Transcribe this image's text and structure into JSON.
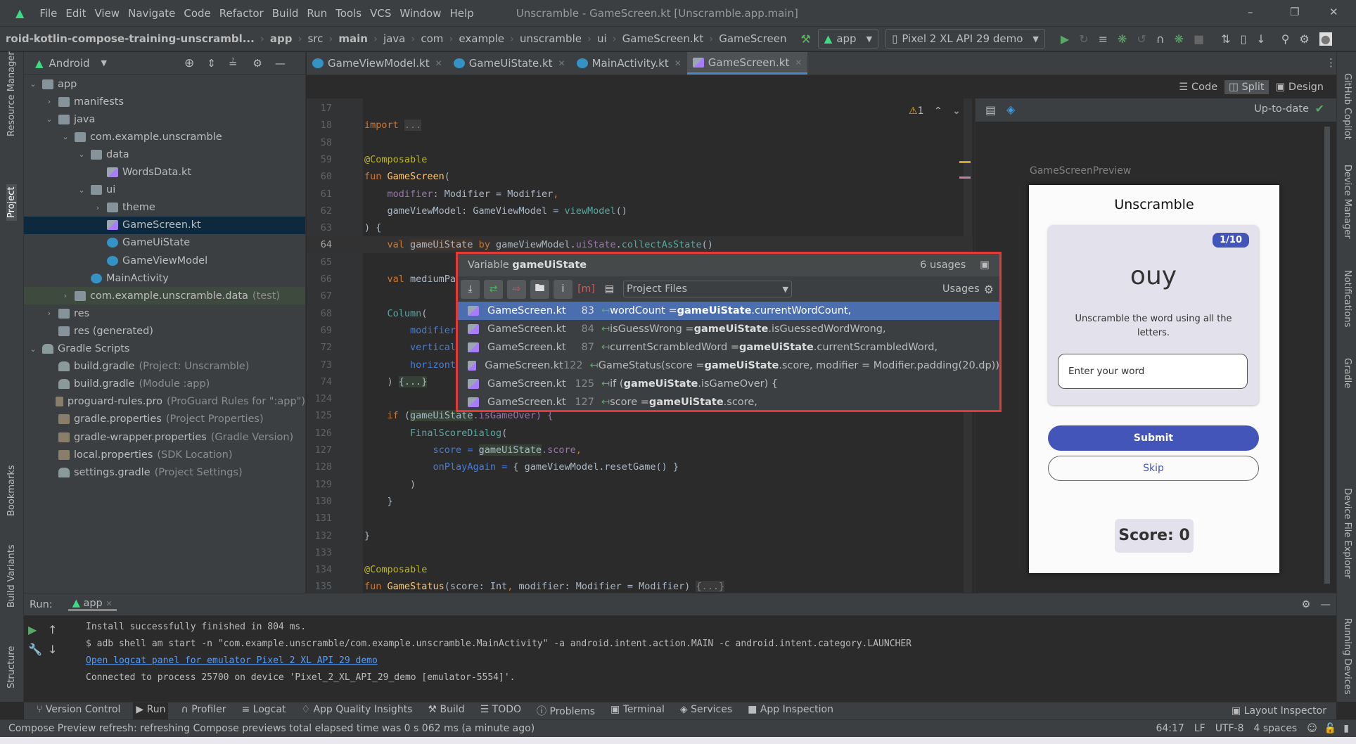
{
  "menubar": {
    "items": [
      "File",
      "Edit",
      "View",
      "Navigate",
      "Code",
      "Refactor",
      "Build",
      "Run",
      "Tools",
      "VCS",
      "Window",
      "Help"
    ],
    "title": "Unscramble - GameScreen.kt [Unscramble.app.main]"
  },
  "breadcrumb": [
    "roid-kotlin-compose-training-unscrambl...",
    "app",
    "src",
    "main",
    "java",
    "com",
    "example",
    "unscramble",
    "ui",
    "GameScreen.kt",
    "GameScreen"
  ],
  "toolbar": {
    "run_config": "app",
    "device": "Pixel 2 XL API 29 demo"
  },
  "project": {
    "view": "Android",
    "tree": [
      {
        "label": "app",
        "depth": 0,
        "state": "open",
        "icon": "folder"
      },
      {
        "label": "manifests",
        "depth": 1,
        "state": "closed",
        "icon": "folder"
      },
      {
        "label": "java",
        "depth": 1,
        "state": "open",
        "icon": "folder"
      },
      {
        "label": "com.example.unscramble",
        "depth": 2,
        "state": "open",
        "icon": "folder"
      },
      {
        "label": "data",
        "depth": 3,
        "state": "open",
        "icon": "folder"
      },
      {
        "label": "WordsData.kt",
        "depth": 4,
        "icon": "kt"
      },
      {
        "label": "ui",
        "depth": 3,
        "state": "open",
        "icon": "folder"
      },
      {
        "label": "theme",
        "depth": 4,
        "state": "closed",
        "icon": "folder"
      },
      {
        "label": "GameScreen.kt",
        "depth": 4,
        "icon": "kt",
        "selected": true
      },
      {
        "label": "GameUiState",
        "depth": 4,
        "icon": "cls"
      },
      {
        "label": "GameViewModel",
        "depth": 4,
        "icon": "cls"
      },
      {
        "label": "MainActivity",
        "depth": 3,
        "icon": "cls"
      },
      {
        "label": "com.example.unscramble.data",
        "hint": "(test)",
        "depth": 2,
        "state": "closed",
        "icon": "folder",
        "test": true
      },
      {
        "label": "res",
        "depth": 1,
        "state": "closed",
        "icon": "folder"
      },
      {
        "label": "res (generated)",
        "depth": 1,
        "icon": "folder"
      },
      {
        "label": "Gradle Scripts",
        "depth": 0,
        "state": "open",
        "icon": "gr"
      },
      {
        "label": "build.gradle",
        "hint": "(Project: Unscramble)",
        "depth": 1,
        "icon": "gr"
      },
      {
        "label": "build.gradle",
        "hint": "(Module :app)",
        "depth": 1,
        "icon": "gr"
      },
      {
        "label": "proguard-rules.pro",
        "hint": "(ProGuard Rules for \":app\")",
        "depth": 1,
        "icon": "prop"
      },
      {
        "label": "gradle.properties",
        "hint": "(Project Properties)",
        "depth": 1,
        "icon": "prop"
      },
      {
        "label": "gradle-wrapper.properties",
        "hint": "(Gradle Version)",
        "depth": 1,
        "icon": "prop"
      },
      {
        "label": "local.properties",
        "hint": "(SDK Location)",
        "depth": 1,
        "icon": "prop"
      },
      {
        "label": "settings.gradle",
        "hint": "(Project Settings)",
        "depth": 1,
        "icon": "gr"
      }
    ]
  },
  "left_stripe": [
    "Resource Manager",
    "Project",
    "Bookmarks",
    "Build Variants",
    "Structure"
  ],
  "right_stripe": [
    "GitHub Copilot",
    "Device Manager",
    "Notifications",
    "Gradle",
    "Device File Explorer",
    "Running Devices"
  ],
  "editor_tabs": [
    {
      "label": "GameViewModel.kt"
    },
    {
      "label": "GameUiState.kt"
    },
    {
      "label": "MainActivity.kt"
    },
    {
      "label": "GameScreen.kt",
      "active": true
    }
  ],
  "view_modes": {
    "code": "Code",
    "split": "Split",
    "design": "Design",
    "active": "Split"
  },
  "inspections": {
    "warnings": "1"
  },
  "code": [
    {
      "n": "17",
      "s": []
    },
    {
      "n": "18",
      "s": [
        [
          "import",
          "kw"
        ],
        [
          " ",
          "tx"
        ],
        [
          "...",
          "gr"
        ]
      ]
    },
    {
      "n": "58",
      "s": []
    },
    {
      "n": "59",
      "s": [
        [
          "@Composable",
          "an"
        ]
      ]
    },
    {
      "n": "60",
      "s": [
        [
          "fun ",
          "kw"
        ],
        [
          "GameScreen",
          "fn"
        ],
        [
          "(",
          "tx"
        ]
      ]
    },
    {
      "n": "61",
      "s": [
        [
          "    ",
          "tx"
        ],
        [
          "modifier",
          "pp"
        ],
        [
          ": Modifier = Modifier",
          "tx"
        ],
        [
          ",",
          "kw"
        ]
      ]
    },
    {
      "n": "62",
      "s": [
        [
          "    gameViewModel: GameViewModel = ",
          "tx"
        ],
        [
          "viewModel",
          "cf"
        ],
        [
          "()",
          "tx"
        ]
      ]
    },
    {
      "n": "63",
      "s": [
        [
          ") {",
          "tx"
        ]
      ]
    },
    {
      "n": "64",
      "s": [
        [
          "    ",
          "tx"
        ],
        [
          "val ",
          "kw"
        ],
        [
          "gameUiState",
          "hv"
        ],
        [
          " by ",
          "kw"
        ],
        [
          "gameViewModel.",
          "tx"
        ],
        [
          "uiState",
          "pp"
        ],
        [
          ".",
          "tx"
        ],
        [
          "collectAsState",
          "cf"
        ],
        [
          "()",
          "tx"
        ]
      ],
      "current": true
    },
    {
      "n": "65",
      "s": []
    },
    {
      "n": "66",
      "s": [
        [
          "    ",
          "tx"
        ],
        [
          "val ",
          "kw"
        ],
        [
          "mediumPa",
          "tx"
        ]
      ]
    },
    {
      "n": "67",
      "s": []
    },
    {
      "n": "68",
      "s": [
        [
          "    ",
          "tx"
        ],
        [
          "Column",
          "cf"
        ],
        [
          "(",
          "tx"
        ]
      ]
    },
    {
      "n": "69",
      "s": [
        [
          "        ",
          "tx"
        ],
        [
          "modifier",
          "np"
        ]
      ]
    },
    {
      "n": "72",
      "s": [
        [
          "        ",
          "tx"
        ],
        [
          "vertical",
          "np"
        ]
      ]
    },
    {
      "n": "73",
      "s": [
        [
          "        ",
          "tx"
        ],
        [
          "horizont",
          "np"
        ]
      ]
    },
    {
      "n": "74",
      "s": [
        [
          "    ) ",
          "tx"
        ],
        [
          "{...}",
          "hl"
        ]
      ]
    },
    {
      "n": "124",
      "s": []
    },
    {
      "n": "125",
      "s": [
        [
          "    ",
          "tx"
        ],
        [
          "if ",
          "kw"
        ],
        [
          "(",
          "tx"
        ],
        [
          "gameUiState",
          "hl"
        ],
        [
          ".isGameOver) {",
          "pp"
        ]
      ]
    },
    {
      "n": "126",
      "s": [
        [
          "        ",
          "tx"
        ],
        [
          "FinalScoreDialog",
          "cf"
        ],
        [
          "(",
          "tx"
        ]
      ]
    },
    {
      "n": "127",
      "s": [
        [
          "            ",
          "tx"
        ],
        [
          "score = ",
          "np"
        ],
        [
          "gameUiState",
          "hl"
        ],
        [
          ".score",
          "pp"
        ],
        [
          ",",
          "kw"
        ]
      ]
    },
    {
      "n": "128",
      "s": [
        [
          "            ",
          "tx"
        ],
        [
          "onPlayAgain = ",
          "np"
        ],
        [
          "{ gameViewModel.resetGame() }",
          "tx"
        ]
      ]
    },
    {
      "n": "129",
      "s": [
        [
          "        )",
          "tx"
        ]
      ]
    },
    {
      "n": "130",
      "s": [
        [
          "    }",
          "tx"
        ]
      ]
    },
    {
      "n": "131",
      "s": []
    },
    {
      "n": "132",
      "s": [
        [
          "}",
          "tx"
        ]
      ]
    },
    {
      "n": "133",
      "s": []
    },
    {
      "n": "134",
      "s": [
        [
          "@Composable",
          "an"
        ]
      ]
    },
    {
      "n": "135",
      "s": [
        [
          "fun ",
          "kw"
        ],
        [
          "GameStatus",
          "fn"
        ],
        [
          "(score: Int",
          "tx"
        ],
        [
          ", ",
          "kw"
        ],
        [
          "modifier: Modifier = Modifier) ",
          "tx"
        ],
        [
          "{...}",
          "gr"
        ]
      ]
    }
  ],
  "usages_popup": {
    "kind": "Variable",
    "name": "gameUiState",
    "count": "6 usages",
    "scope": "Project Files",
    "usages_label": "Usages",
    "rows": [
      {
        "file": "GameScreen.kt",
        "line": "83",
        "pre": "wordCount = ",
        "bold": "gameUiState",
        "post": ".currentWordCount,",
        "selected": true
      },
      {
        "file": "GameScreen.kt",
        "line": "84",
        "pre": "isGuessWrong = ",
        "bold": "gameUiState",
        "post": ".isGuessedWordWrong,"
      },
      {
        "file": "GameScreen.kt",
        "line": "87",
        "pre": "currentScrambledWord = ",
        "bold": "gameUiState",
        "post": ".currentScrambledWord,"
      },
      {
        "file": "GameScreen.kt",
        "line": "122",
        "pre": "GameStatus(score = ",
        "bold": "gameUiState",
        "post": ".score, modifier = Modifier.padding(20.dp))"
      },
      {
        "file": "GameScreen.kt",
        "line": "125",
        "pre": "if (",
        "bold": "gameUiState",
        "post": ".isGameOver) {"
      },
      {
        "file": "GameScreen.kt",
        "line": "127",
        "pre": "score = ",
        "bold": "gameUiState",
        "post": ".score,"
      }
    ]
  },
  "preview": {
    "status": "Up-to-date",
    "name": "GameScreenPreview",
    "app_title": "Unscramble",
    "counter": "1/10",
    "word": "ouy",
    "instructions": "Unscramble the word using all the letters.",
    "input_placeholder": "Enter your word",
    "submit": "Submit",
    "skip": "Skip",
    "score": "Score: 0",
    "accent": "#4355b9"
  },
  "run": {
    "label": "Run:",
    "config": "app",
    "log": [
      "Install successfully finished in 804 ms.",
      "$ adb shell am start -n \"com.example.unscramble/com.example.unscramble.MainActivity\" -a android.intent.action.MAIN -c android.intent.category.LAUNCHER",
      "Open logcat panel for emulator Pixel 2 XL API 29 demo",
      "Connected to process 25700 on device 'Pixel_2_XL_API_29_demo [emulator-5554]'."
    ]
  },
  "bottom_tabs": [
    "Version Control",
    "Run",
    "Profiler",
    "Logcat",
    "App Quality Insights",
    "Build",
    "TODO",
    "Problems",
    "Terminal",
    "Services",
    "App Inspection"
  ],
  "layout_inspector": "Layout Inspector",
  "status": {
    "message": "Compose Preview refresh: refreshing Compose previews total elapsed time was 0 s 062 ms (a minute ago)",
    "position": "64:17",
    "line_sep": "LF",
    "encoding": "UTF-8",
    "indent": "4 spaces"
  }
}
